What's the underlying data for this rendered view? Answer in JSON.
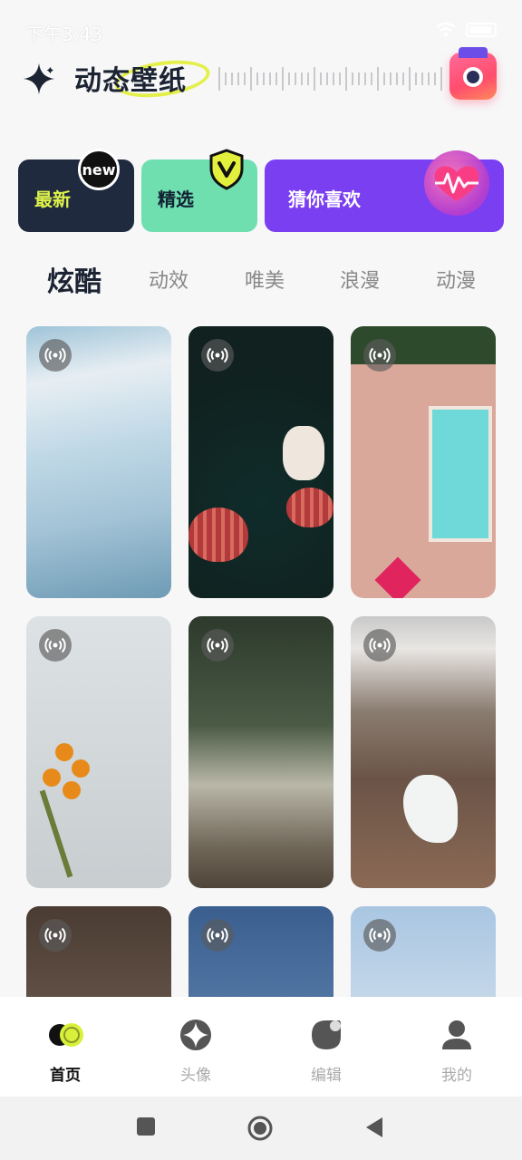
{
  "status_bar": {
    "time": "下午3:43",
    "icons": [
      "alarm-icon",
      "notification-icons",
      "more-dots",
      "sim-icon",
      "wifi-icon",
      "battery-icon"
    ],
    "dots": "···"
  },
  "header": {
    "title": "动态壁纸",
    "camera_icon": "camera-icon",
    "sparkle_icon": "sparkle-icon",
    "highlight_color": "#e4f04a"
  },
  "categories": [
    {
      "label": "最新",
      "badge": "new",
      "bg": "#1f2a3f"
    },
    {
      "label": "精选",
      "badge_icon": "v-shield-icon",
      "bg": "#6fdfb0"
    },
    {
      "label": "猜你喜欢",
      "badge_icon": "heart-wave-icon",
      "bg": "#7b3ff2"
    }
  ],
  "tabs": [
    {
      "label": "炫酷",
      "active": true
    },
    {
      "label": "动效",
      "active": false
    },
    {
      "label": "唯美",
      "active": false
    },
    {
      "label": "浪漫",
      "active": false
    },
    {
      "label": "动漫",
      "active": false
    }
  ],
  "wallpapers": [
    {
      "subject": "icy water",
      "live": true
    },
    {
      "subject": "christmas ornaments",
      "live": true
    },
    {
      "subject": "pool aerial",
      "live": true
    },
    {
      "subject": "sunflowers bouquet",
      "live": true
    },
    {
      "subject": "eucalyptus bark",
      "live": true
    },
    {
      "subject": "mountain canyon",
      "live": true
    },
    {
      "subject": "roast dinner",
      "live": true
    },
    {
      "subject": "cherry blossoms",
      "live": true
    },
    {
      "subject": "sea cliff",
      "live": true
    }
  ],
  "bottom_nav": [
    {
      "label": "首页",
      "icon": "home-toggle-icon",
      "active": true
    },
    {
      "label": "头像",
      "icon": "star-diamond-icon",
      "active": false
    },
    {
      "label": "编辑",
      "icon": "edit-blob-icon",
      "active": false
    },
    {
      "label": "我的",
      "icon": "user-icon",
      "active": false
    }
  ]
}
